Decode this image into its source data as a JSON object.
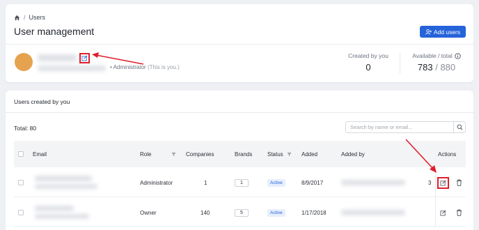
{
  "breadcrumb": {
    "home_icon": "home-icon",
    "separator": "/",
    "current": "Users"
  },
  "page": {
    "title": "User management"
  },
  "toolbar": {
    "add_users_label": "Add users",
    "add_users_icon": "add-user-icon"
  },
  "profile": {
    "role": "Administrator",
    "note": "(This is you.)",
    "edit_icon": "edit-icon"
  },
  "stats": {
    "created_label": "Created by you",
    "created_value": "0",
    "available_label": "Available / total",
    "available_value": "783",
    "available_sep": "/",
    "total_value": "880",
    "info_icon": "info-icon"
  },
  "section": {
    "title": "Users created by you"
  },
  "table": {
    "total_text": "Total: 80",
    "search_placeholder": "Search by name or email...",
    "headers": {
      "email": "Email",
      "role": "Role",
      "companies": "Companies",
      "brands": "Brands",
      "status": "Status",
      "added": "Added",
      "added_by": "Added by",
      "actions": "Actions"
    },
    "rows": [
      {
        "role": "Administrator",
        "companies": "1",
        "brands": "1",
        "status": "Active",
        "added": "8/9/2017",
        "extra": "3"
      },
      {
        "role": "Owner",
        "companies": "140",
        "brands": "5",
        "status": "Active",
        "added": "1/17/2018",
        "extra": ""
      }
    ]
  },
  "colors": {
    "accent": "#2563d9",
    "annotation_red": "#e01e2b",
    "avatar": "#e5a34f"
  }
}
